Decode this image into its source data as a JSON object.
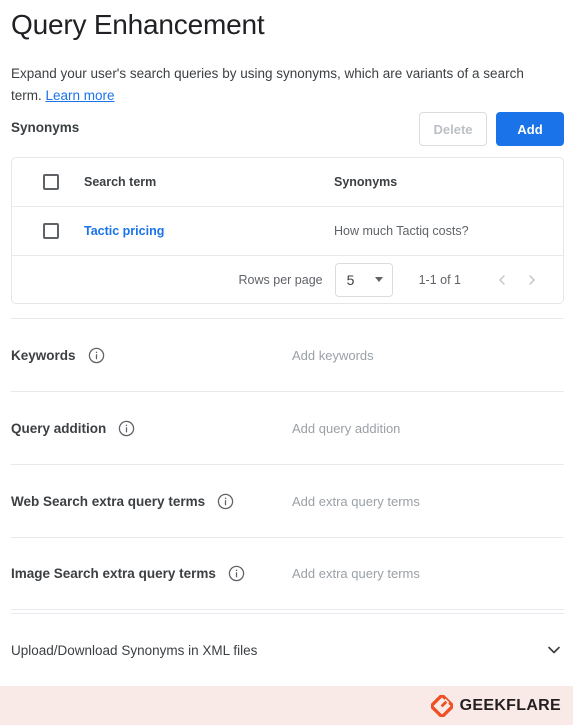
{
  "page": {
    "title": "Query Enhancement",
    "description_before_link": "Expand your user's search queries by using synonyms, which are variants of a search term. ",
    "learn_more_label": "Learn more"
  },
  "synonyms_section": {
    "label": "Synonyms",
    "delete_button": "Delete",
    "add_button": "Add",
    "add_button_color": "#1a73e8",
    "delete_button_text_color": "#bdc1c6"
  },
  "table": {
    "columns": [
      "Search term",
      "Synonyms"
    ],
    "rows": [
      {
        "checked": false,
        "search_term": "Tactic pricing",
        "synonyms": "How much Tactiq costs?"
      }
    ],
    "pagination": {
      "rows_per_page_label": "Rows per page",
      "rows_per_page_value": "5",
      "range_label": "1-1 of 1",
      "prev_icon": "chevron-left-icon",
      "next_icon": "chevron-right-icon"
    }
  },
  "settings": [
    {
      "label": "Keywords",
      "info_icon": "info-icon",
      "value": "Add keywords"
    },
    {
      "label": "Query addition",
      "info_icon": "info-icon",
      "value": "Add query addition"
    },
    {
      "label": "Web Search extra query terms",
      "info_icon": "info-icon",
      "value": "Add extra query terms"
    },
    {
      "label": "Image Search extra query terms",
      "info_icon": "info-icon",
      "value": "Add extra query terms"
    }
  ],
  "expander": {
    "label": "Upload/Download Synonyms in XML files",
    "icon": "chevron-down-icon"
  },
  "footer": {
    "brand": "GEEKFLARE",
    "logo_icon": "geekflare-logo-icon",
    "background_color": "#faeae7",
    "logo_color": "#f04e23"
  }
}
